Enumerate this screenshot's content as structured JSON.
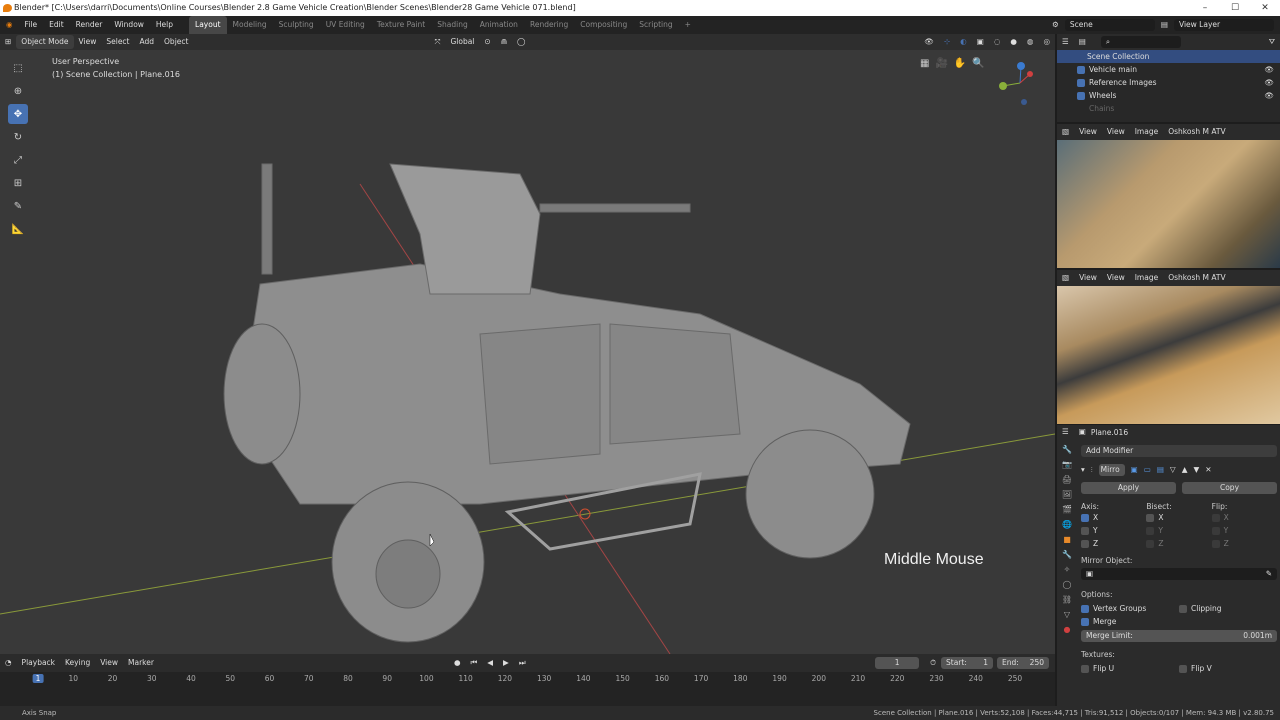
{
  "window": {
    "title": "Blender* [C:\\Users\\darri\\Documents\\Online Courses\\Blender 2.8 Game Vehicle Creation\\Blender Scenes\\Blender28 Game Vehicle 071.blend]"
  },
  "menus": [
    "File",
    "Edit",
    "Render",
    "Window",
    "Help"
  ],
  "workspaces": [
    "Layout",
    "Modeling",
    "Sculpting",
    "UV Editing",
    "Texture Paint",
    "Shading",
    "Animation",
    "Rendering",
    "Compositing",
    "Scripting"
  ],
  "active_workspace": "Layout",
  "scene": {
    "name": "Scene",
    "view_layer": "View Layer"
  },
  "viewport": {
    "mode": "Object Mode",
    "menus": [
      "View",
      "Select",
      "Add",
      "Object"
    ],
    "orientation": "Global",
    "perspective": "User Perspective",
    "collection_info": "(1) Scene Collection | Plane.016",
    "overlay_hint": "Middle Mouse"
  },
  "outliner": {
    "root": "Scene Collection",
    "items": [
      "Vehicle main",
      "Reference Images",
      "Wheels",
      "Chains"
    ]
  },
  "image_editor": {
    "menus": [
      "View",
      "View",
      "Image"
    ],
    "image_name": "Oshkosh M ATV"
  },
  "properties": {
    "object": "Plane.016",
    "add_modifier": "Add Modifier",
    "modifier_name": "Mirro",
    "apply": "Apply",
    "copy": "Copy",
    "axis_label": "Axis:",
    "bisect_label": "Bisect:",
    "flip_label": "Flip:",
    "axes": [
      "X",
      "Y",
      "Z"
    ],
    "mirror_object_label": "Mirror Object:",
    "options_label": "Options:",
    "vertex_groups": "Vertex Groups",
    "clipping": "Clipping",
    "merge": "Merge",
    "merge_limit_label": "Merge Limit:",
    "merge_limit_value": "0.001m",
    "textures_label": "Textures:",
    "flip_u": "Flip U",
    "flip_v": "Flip V"
  },
  "timeline": {
    "menus": [
      "Playback",
      "Keying",
      "View",
      "Marker"
    ],
    "current_frame": "1",
    "start_label": "Start:",
    "start": "1",
    "end_label": "End:",
    "end": "250",
    "ticks": [
      "1",
      "10",
      "20",
      "30",
      "40",
      "50",
      "60",
      "70",
      "80",
      "90",
      "100",
      "110",
      "120",
      "130",
      "140",
      "150",
      "160",
      "170",
      "180",
      "190",
      "200",
      "210",
      "220",
      "230",
      "240",
      "250"
    ]
  },
  "status": {
    "left": "Axis Snap",
    "right": "Scene Collection | Plane.016 | Verts:52,108 | Faces:44,715 | Tris:91,512 | Objects:0/107 | Mem: 94.3 MB | v2.80.75"
  },
  "colors": {
    "accent": "#4772b3",
    "viewport_bg": "#393939",
    "header": "#2b2b2b"
  }
}
